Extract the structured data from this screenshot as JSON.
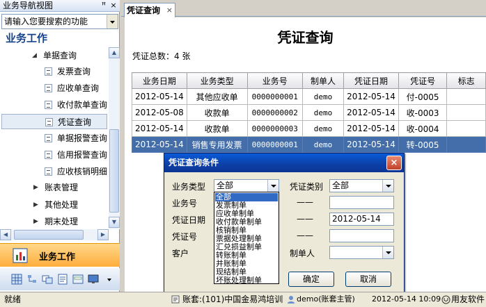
{
  "nav": {
    "title": "业务导航视图",
    "pin": "ꟸ",
    "close": "×",
    "search_placeholder": "请输入您要搜索的功能",
    "header": "业务工作",
    "tree": [
      {
        "label": "单据查询",
        "kind": "expanded"
      },
      {
        "label": "发票查询",
        "kind": "doc"
      },
      {
        "label": "应收单查询",
        "kind": "doc"
      },
      {
        "label": "收付款单查询",
        "kind": "doc"
      },
      {
        "label": "凭证查询",
        "kind": "doc",
        "selected": true
      },
      {
        "label": "单据报警查询",
        "kind": "doc"
      },
      {
        "label": "信用报警查询",
        "kind": "doc"
      },
      {
        "label": "应收核销明细",
        "kind": "doc"
      },
      {
        "label": "账表管理",
        "kind": "collapsed"
      },
      {
        "label": "其他处理",
        "kind": "collapsed"
      },
      {
        "label": "期末处理",
        "kind": "collapsed"
      }
    ],
    "business_label": "业务工作"
  },
  "tab": {
    "label": "凭证查询",
    "close": "×"
  },
  "page": {
    "title": "凭证查询",
    "count_label": "凭证总数：4 张"
  },
  "grid": {
    "columns": [
      "业务日期",
      "业务类型",
      "业务号",
      "制单人",
      "凭证日期",
      "凭证号",
      "标志"
    ],
    "rows": [
      [
        "2012-05-14",
        "其他应收单",
        "0000000001",
        "demo",
        "2012-05-14",
        "付-0005",
        ""
      ],
      [
        "2012-05-08",
        "收款单",
        "0000000002",
        "demo",
        "2012-05-14",
        "收-0003",
        ""
      ],
      [
        "2012-05-14",
        "收款单",
        "0000000003",
        "demo",
        "2012-05-14",
        "收-0004",
        ""
      ],
      [
        "2012-05-14",
        "销售专用发票",
        "0000000001",
        "demo",
        "2012-05-14",
        "转-0005",
        ""
      ]
    ],
    "selected_row": 3
  },
  "dialog": {
    "title": "凭证查询条件",
    "close": "×",
    "labels": {
      "biz_type": "业务类型",
      "biz_no": "业务号",
      "voucher_date": "凭证日期",
      "voucher_no": "凭证号",
      "customer": "客户",
      "voucher_category": "凭证类别",
      "maker": "制单人"
    },
    "biz_type_value": "全部",
    "voucher_category_value": "全部",
    "dash": "——",
    "date_to_value": "2012-05-14",
    "ok": "确定",
    "cancel": "取消",
    "options": [
      "全部",
      "发票制单",
      "应收单制单",
      "收付款单制单",
      "核销制单",
      "票据处理制单",
      "汇兑损益制单",
      "转账制单",
      "并账制单",
      "现结制单",
      "坏账处理制单"
    ]
  },
  "status": {
    "ready": "就绪",
    "account": "账套:(101)中国金易鸿培训",
    "user": "demo(账套主管)",
    "datetime": "2012-05-14 10:09",
    "vendor": "用友软件"
  },
  "colors": {
    "accent": "#436ea9",
    "dialog_title": "#0a5ad8",
    "business_bar": "#ffad3c"
  }
}
